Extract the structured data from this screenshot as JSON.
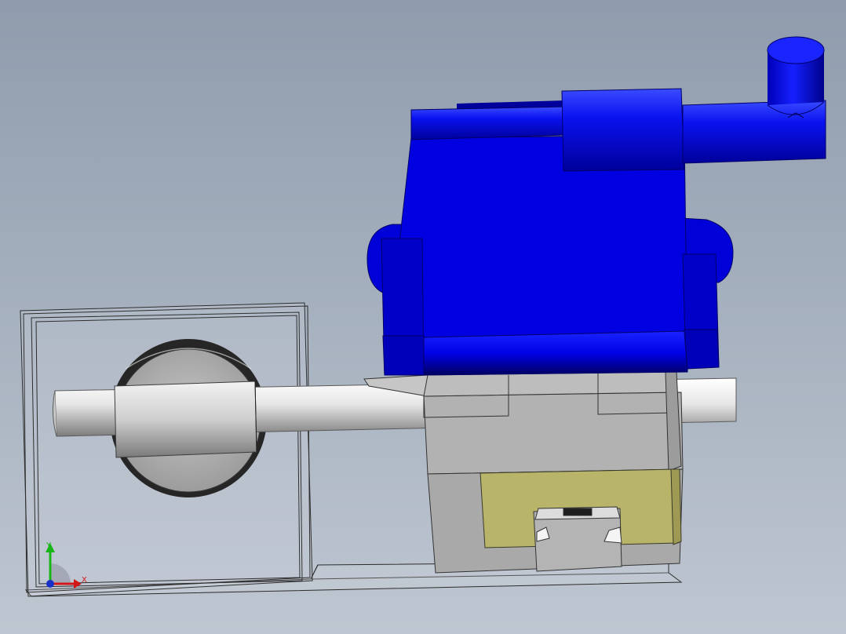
{
  "viewport": {
    "background_top": "#8f9cad",
    "background_bottom": "#bec6d1"
  },
  "triad": {
    "x_label": "X",
    "y_label": "Y",
    "x_color": "#d01818",
    "y_color": "#18b418",
    "z_color": "#1830c8"
  },
  "colors": {
    "pump_blue": "#0000e0",
    "shaft_gray": "#d8d8d8",
    "block_gray": "#b0b0b0",
    "rail_yellow": "#b8b46a"
  }
}
